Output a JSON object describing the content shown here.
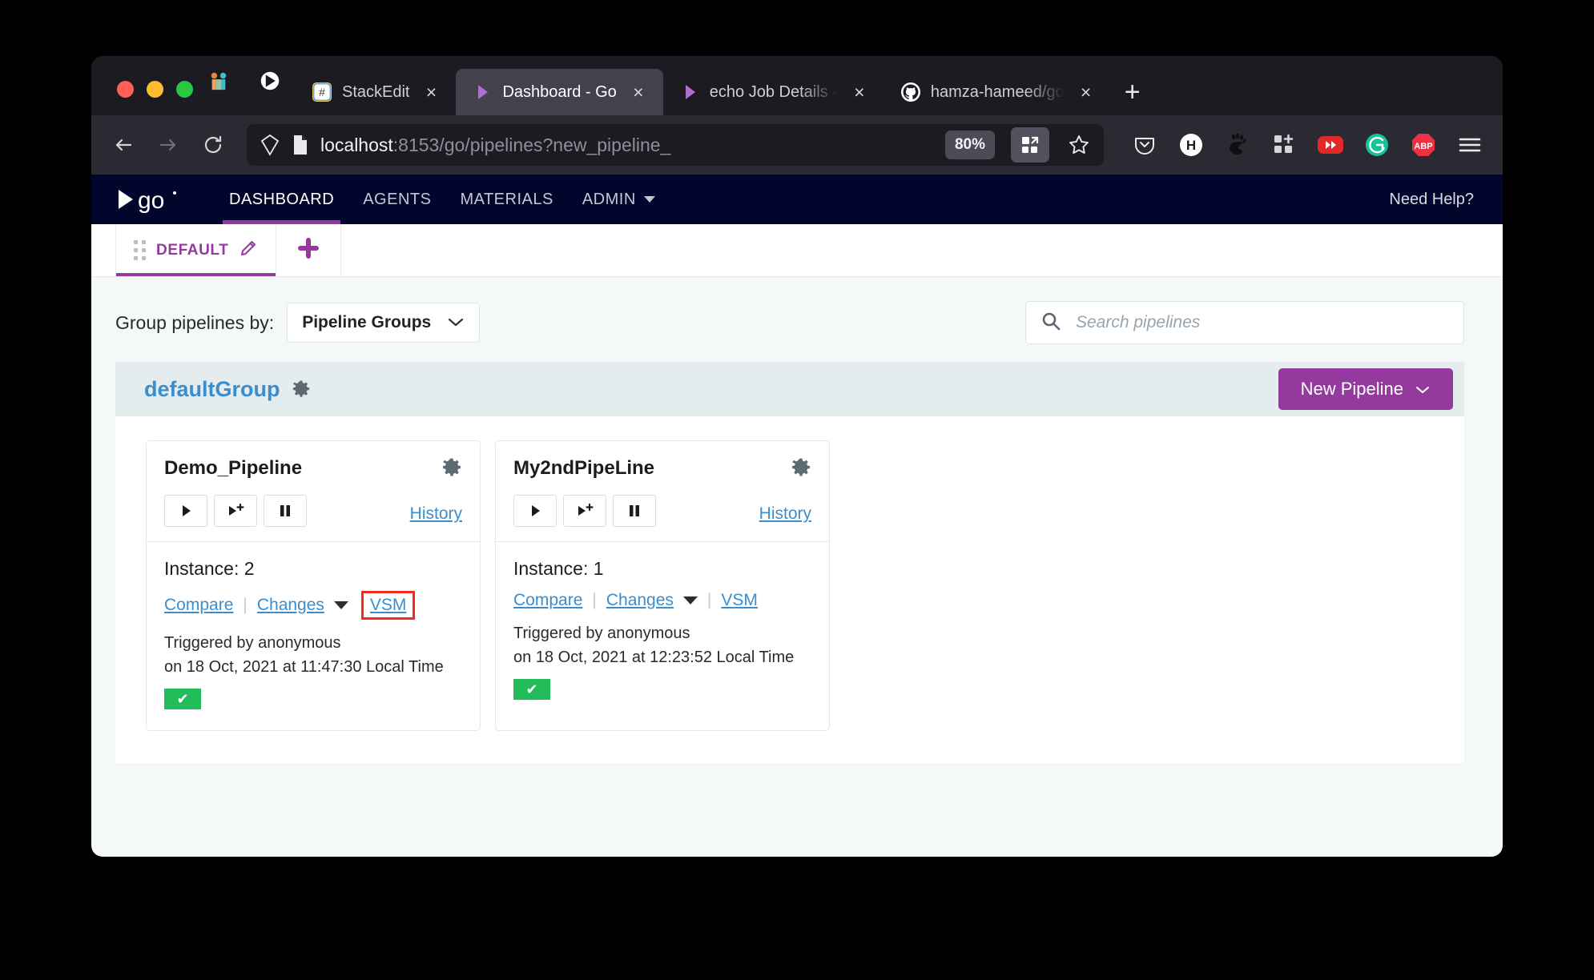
{
  "browser": {
    "tabs": [
      {
        "label": "StackEdit",
        "icon": "stackedit-icon",
        "active": false,
        "truncated": false
      },
      {
        "label": "Dashboard - Go",
        "icon": "gocd-icon",
        "active": true,
        "truncated": false
      },
      {
        "label": "echo Job Details -",
        "icon": "gocd-icon",
        "active": false,
        "truncated": true
      },
      {
        "label": "hamza-hameed/go",
        "icon": "github-icon",
        "active": false,
        "truncated": true
      }
    ],
    "pinned": [
      "mailspring-icon",
      "gocd-icon"
    ],
    "new_tab_label": "+",
    "close_label": "×",
    "nav": {
      "back_label": "←",
      "forward_label": "→",
      "reload_label": "↻"
    },
    "url": {
      "host": "localhost",
      "rest": ":8153/go/pipelines?new_pipeline_",
      "zoom": "80%"
    },
    "extensions": [
      "pocket-icon",
      "h-circle-icon",
      "gnome-icon",
      "addon-grid-icon",
      "video-speed-icon",
      "grammarly-icon",
      "abp-icon"
    ],
    "menu_label": "menu-icon"
  },
  "gocd": {
    "logo": "go-logo",
    "nav_items": [
      {
        "label": "DASHBOARD",
        "active": true,
        "dropdown": false
      },
      {
        "label": "AGENTS",
        "active": false,
        "dropdown": false
      },
      {
        "label": "MATERIALS",
        "active": false,
        "dropdown": false
      },
      {
        "label": "ADMIN",
        "active": false,
        "dropdown": true
      }
    ],
    "need_help": "Need Help?",
    "personalize": {
      "tab_label": "DEFAULT",
      "edit_icon": "pencil-icon",
      "add_label": "+"
    },
    "controls": {
      "group_by_label": "Group pipelines by:",
      "group_by_value": "Pipeline Groups",
      "search_placeholder": "Search pipelines",
      "search_value": ""
    },
    "group": {
      "name": "defaultGroup",
      "settings_icon": "gear-icon",
      "new_pipeline_label": "New Pipeline"
    },
    "pipelines": [
      {
        "name": "Demo_Pipeline",
        "settings_icon": "gear-icon",
        "operations": [
          "play-icon",
          "play-with-options-icon",
          "pause-icon"
        ],
        "history_label": "History",
        "instance_label": "Instance: 2",
        "compare_label": "Compare",
        "changes_label": "Changes",
        "vsm_label": "VSM",
        "vsm_highlighted": true,
        "triggered_by": "Triggered by anonymous",
        "triggered_on": "on 18 Oct, 2021 at 11:47:30 Local Time",
        "status": "passed",
        "status_glyph": "✔"
      },
      {
        "name": "My2ndPipeLine",
        "settings_icon": "gear-icon",
        "operations": [
          "play-icon",
          "play-with-options-icon",
          "pause-icon"
        ],
        "history_label": "History",
        "instance_label": "Instance: 1",
        "compare_label": "Compare",
        "changes_label": "Changes",
        "vsm_label": "VSM",
        "vsm_highlighted": false,
        "triggered_by": "Triggered by anonymous",
        "triggered_on": "on 18 Oct, 2021 at 12:23:52 Local Time",
        "status": "passed",
        "status_glyph": "✔"
      }
    ]
  },
  "colors": {
    "brand_purple": "#943a9e",
    "link_blue": "#3a8ecd",
    "nav_dark": "#02062c",
    "status_green": "#22bd5a",
    "highlight_red": "#ef2b1f"
  }
}
